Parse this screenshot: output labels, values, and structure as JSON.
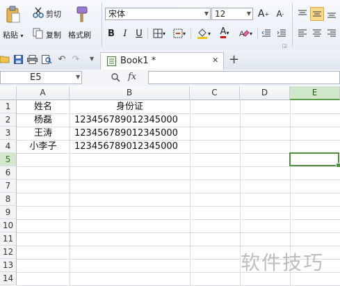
{
  "ribbon": {
    "clipboard": {
      "paste": "粘贴",
      "cut": "剪切",
      "copy": "复制",
      "format_painter": "格式刷"
    },
    "font_name": "宋体",
    "font_size": "12",
    "grow_font": "A",
    "shrink_font": "A",
    "bold": "B",
    "italic": "I",
    "underline": "U",
    "font_color_letter": "A"
  },
  "tabbar": {
    "doc_tab": "Book1 *",
    "close": "✕",
    "new_tab": "+"
  },
  "formula_bar": {
    "name_box": "E5",
    "fx": "fx",
    "formula": ""
  },
  "sheet": {
    "columns": [
      "A",
      "B",
      "C",
      "D",
      "E"
    ],
    "selected_column": "E",
    "rows": [
      "1",
      "2",
      "3",
      "4",
      "5",
      "6",
      "7",
      "8",
      "9",
      "10",
      "11",
      "12",
      "13",
      "14"
    ],
    "selected_row": "5",
    "cells": [
      {
        "a": "姓名",
        "b": "身份证"
      },
      {
        "a": "杨磊",
        "b": "123456789012345000"
      },
      {
        "a": "王涛",
        "b": "123456789012345000"
      },
      {
        "a": "小李子",
        "b": "123456789012345000"
      }
    ],
    "selected_cell": "E5"
  },
  "watermark": "软件技巧",
  "colors": {
    "selection": "#4f8f3e",
    "ribbon_bg": "#e8eef6"
  }
}
